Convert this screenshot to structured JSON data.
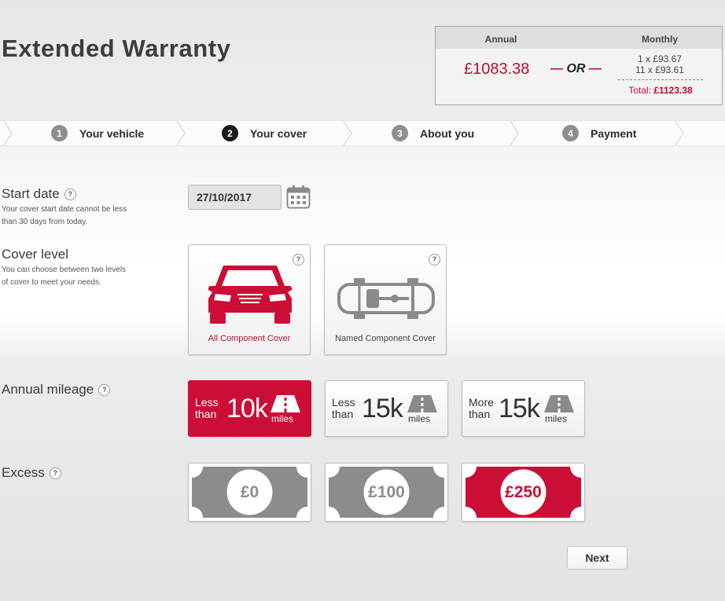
{
  "page": {
    "title": "Extended Warranty"
  },
  "price": {
    "annual_heading": "Annual",
    "monthly_heading": "Monthly",
    "annual_price": "£1083.38",
    "or_text": "OR",
    "monthly_first": "1 x £93.67",
    "monthly_rest": "11 x £93.61",
    "total_label": "Total:",
    "total_value": "£1123.38"
  },
  "steps": [
    {
      "number": "1",
      "label": "Your vehicle"
    },
    {
      "number": "2",
      "label": "Your cover"
    },
    {
      "number": "3",
      "label": "About you"
    },
    {
      "number": "4",
      "label": "Payment"
    }
  ],
  "active_step": 2,
  "start_date": {
    "label": "Start date",
    "help": "?",
    "description": "Your cover start date cannot be less than 30 days from today.",
    "value": "27/10/2017"
  },
  "cover_level": {
    "label": "Cover level",
    "description": "You can choose between two levels of cover to meet your needs.",
    "options": [
      {
        "label": "All Component Cover",
        "help": "?",
        "selected": true,
        "icon": "car-front-icon"
      },
      {
        "label": "Named Component Cover",
        "help": "?",
        "selected": false,
        "icon": "chassis-icon"
      }
    ]
  },
  "annual_mileage": {
    "label": "Annual mileage",
    "help": "?",
    "options": [
      {
        "prefix_line1": "Less",
        "prefix_line2": "than",
        "amount": "10k",
        "unit": "miles",
        "selected": true,
        "icon": "road-icon"
      },
      {
        "prefix_line1": "Less",
        "prefix_line2": "than",
        "amount": "15k",
        "unit": "miles",
        "selected": false,
        "icon": "road-icon"
      },
      {
        "prefix_line1": "More",
        "prefix_line2": "than",
        "amount": "15k",
        "unit": "miles",
        "selected": false,
        "icon": "road-icon"
      }
    ]
  },
  "excess": {
    "label": "Excess",
    "help": "?",
    "options": [
      {
        "amount": "£0",
        "selected": false
      },
      {
        "amount": "£100",
        "selected": false
      },
      {
        "amount": "£250",
        "selected": true
      }
    ]
  },
  "actions": {
    "next_label": "Next"
  },
  "colors": {
    "accent": "#cc0e37",
    "price_red": "#b8102e",
    "inactive_grey": "#8e8e8e"
  }
}
